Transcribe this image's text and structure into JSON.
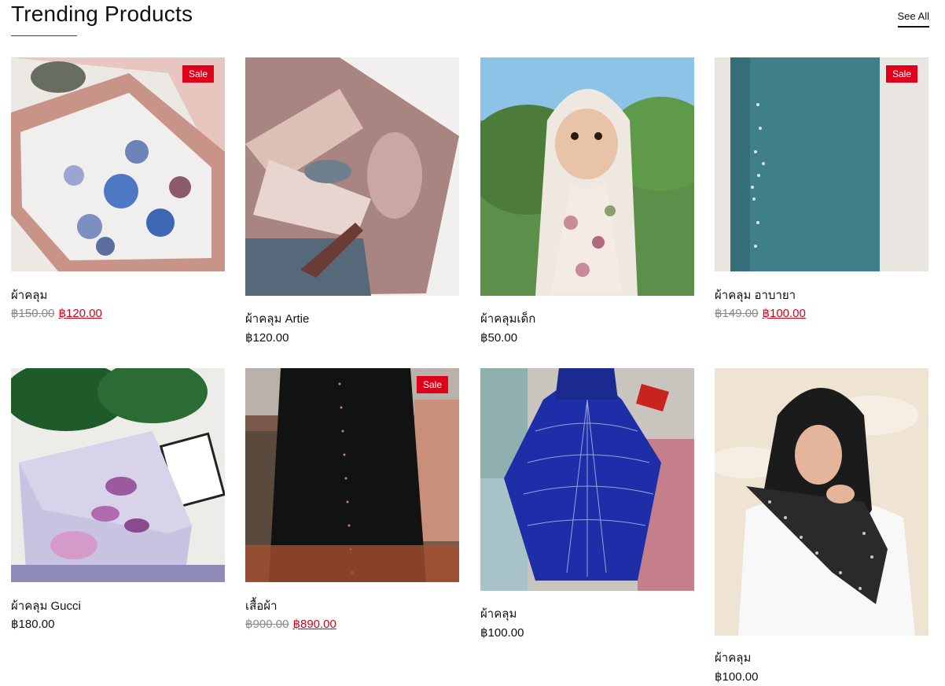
{
  "header": {
    "title": "Trending Products",
    "see_all": "See All"
  },
  "colors": {
    "accent": "#d0021b",
    "sale_badge": "#e0001b",
    "old_price": "#8a8a8a"
  },
  "products": [
    {
      "name": "ผ้าคลุม",
      "badge": "Sale",
      "old_price": "฿150.00",
      "price": "฿120.00",
      "on_sale": true
    },
    {
      "name": "ผ้าคลุม Artie",
      "badge": "",
      "old_price": "",
      "price": "฿120.00",
      "on_sale": false
    },
    {
      "name": "ผ้าคลุมเด็ก",
      "badge": "",
      "old_price": "",
      "price": "฿50.00",
      "on_sale": false
    },
    {
      "name": "ผ้าคลุม อาบายา",
      "badge": "Sale",
      "old_price": "฿149.00",
      "price": "฿100.00",
      "on_sale": true
    },
    {
      "name": "ผ้าคลุม Gucci",
      "badge": "",
      "old_price": "",
      "price": "฿180.00",
      "on_sale": false
    },
    {
      "name": "เสื้อผ้า",
      "badge": "Sale",
      "old_price": "฿900.00",
      "price": "฿890.00",
      "on_sale": true
    },
    {
      "name": "ผ้าคลุม",
      "badge": "",
      "old_price": "",
      "price": "฿100.00",
      "on_sale": false
    },
    {
      "name": "ผ้าคลุม",
      "badge": "",
      "old_price": "",
      "price": "฿100.00",
      "on_sale": false
    }
  ]
}
